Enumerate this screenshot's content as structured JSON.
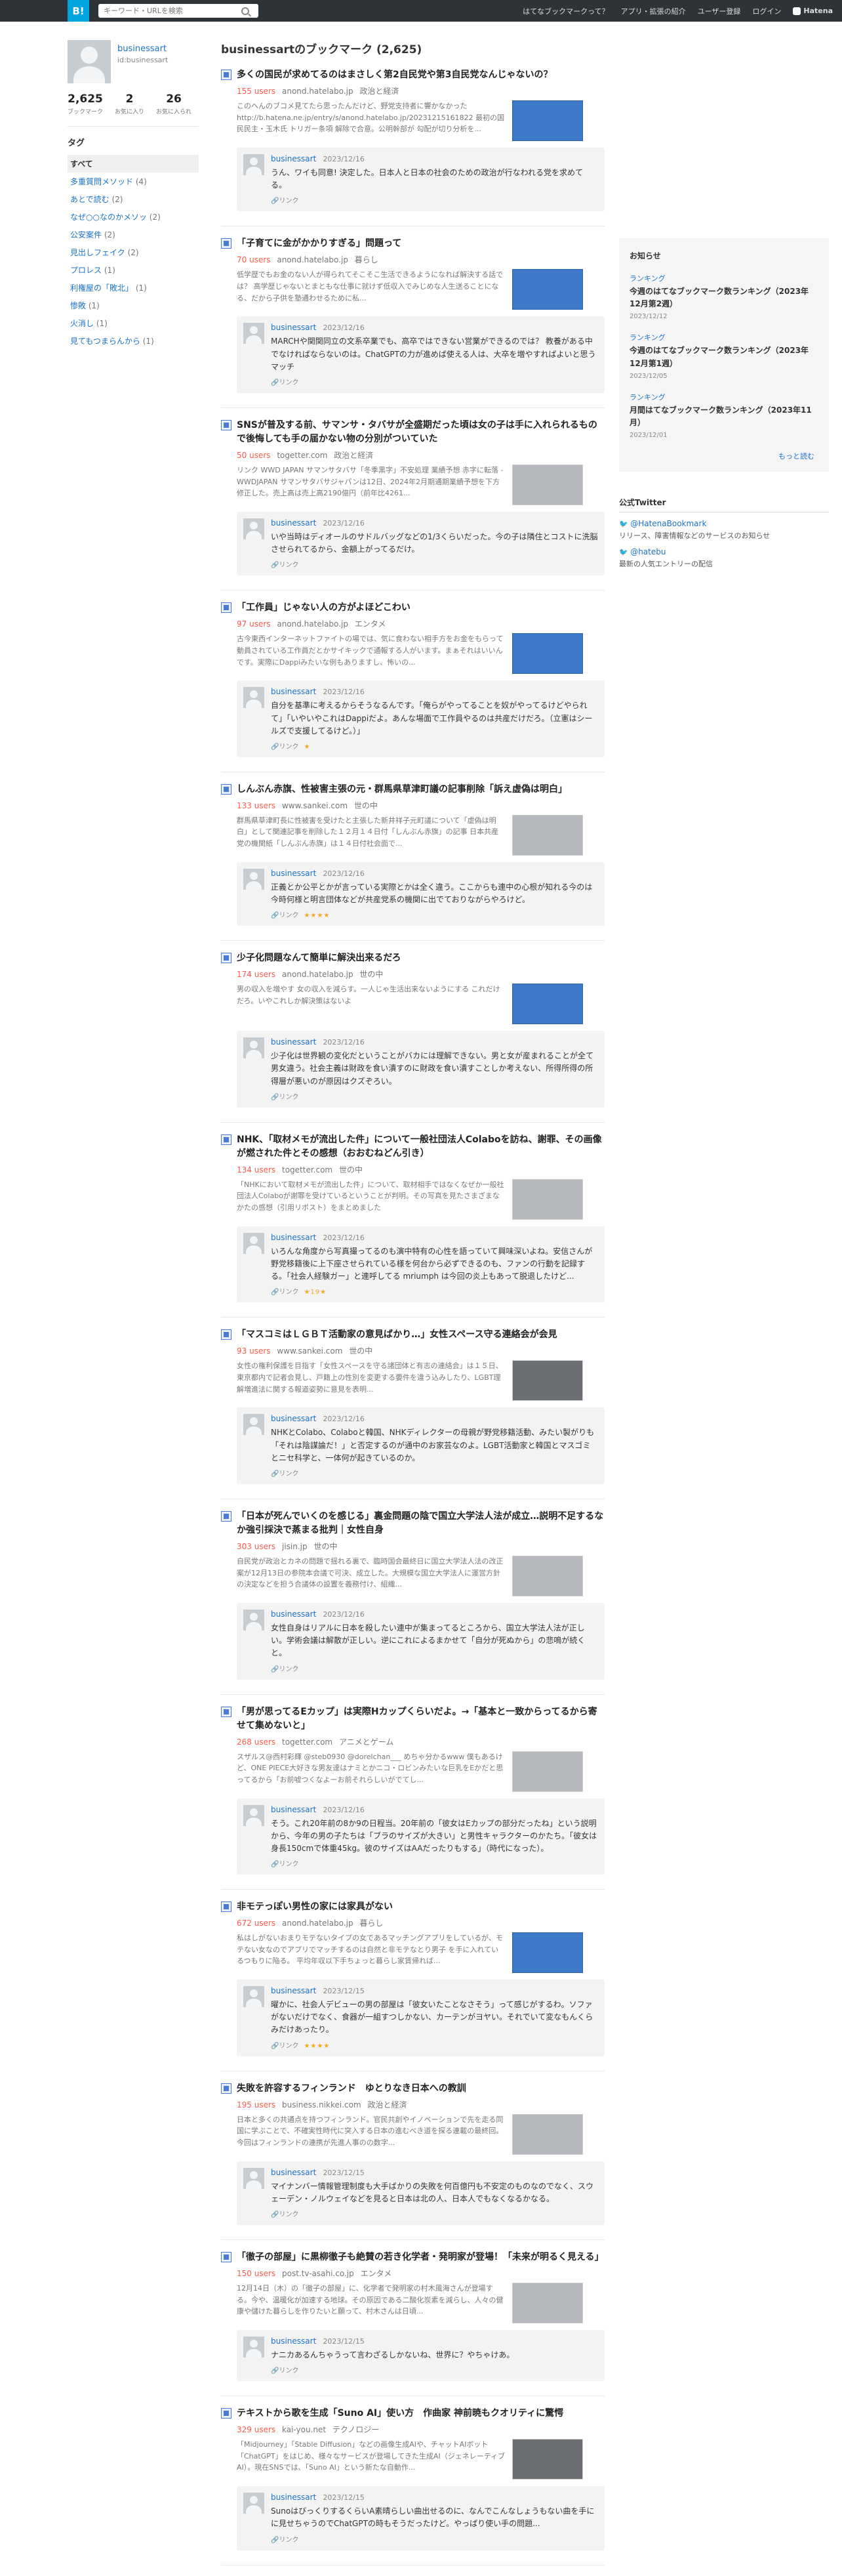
{
  "topbar": {
    "logo": "B!",
    "search_placeholder": "キーワード・URLを検索",
    "nav": [
      "はてなブックマークって？",
      "アプリ・拡張の紹介",
      "ユーザー登録",
      "ログイン"
    ],
    "brand": "Hatena"
  },
  "profile": {
    "name": "businessart",
    "id": "id:businessart",
    "stats": [
      {
        "num": "2,625",
        "label": "ブックマーク"
      },
      {
        "num": "2",
        "label": "お気に入り"
      },
      {
        "num": "26",
        "label": "お気に入られ"
      }
    ]
  },
  "tags": {
    "title": "タグ",
    "items": [
      {
        "label": "すべて",
        "count": ""
      },
      {
        "label": "多重質問メソッド",
        "count": "(4)"
      },
      {
        "label": "あとで読む",
        "count": "(2)"
      },
      {
        "label": "なぜ○○なのかメソッ",
        "count": "(2)"
      },
      {
        "label": "公安案件",
        "count": "(2)"
      },
      {
        "label": "見出しフェイク",
        "count": "(2)"
      },
      {
        "label": "プロレス",
        "count": "(1)"
      },
      {
        "label": "利権屋の「敗北」",
        "count": "(1)"
      },
      {
        "label": "惨敗",
        "count": "(1)"
      },
      {
        "label": "火消し",
        "count": "(1)"
      },
      {
        "label": "見てもつまらんから",
        "count": "(1)"
      }
    ]
  },
  "main": {
    "title": "businessartのブックマーク (2,625)",
    "entries": [
      {
        "title": "多くの国民が求めてるのはまさしく第2自民党や第3自民党なんじゃないの？",
        "users": "155 users",
        "domain": "anond.hatelabo.jp",
        "category": "政治と経済",
        "summary": "このへんのブコメ見てたら思ったんだけど、野党支持者に響かなかった http://b.hatena.ne.jp/entry/s/anond.hatelabo.jp/20231215161822 最初の国民民主・玉木氏 トリガー条項 解除で合意。公明幹部が 勾配が切り分析を...",
        "thumb": "blue",
        "comment_user": "businessart",
        "comment_date": "2023/12/16",
        "comment": "うん、ワイも同意! 決定した。日本人と日本の社会のための政治が行なわれる党を求めてる。",
        "stars": ""
      },
      {
        "title": "「子育てに金がかかりすぎる」問題って",
        "users": "70 users",
        "domain": "anond.hatelabo.jp",
        "category": "暮らし",
        "summary": "低学歴でもお金のない人が得られてそこそこ生活できるようになれば解決する話では？ 高学歴じゃないとまともな仕事に就けず低収入でみじめな人生送ることになる、だから子供を塾通わせるために私...",
        "thumb": "blue",
        "comment_user": "businessart",
        "comment_date": "2023/12/16",
        "comment": "MARCHや関関同立の文系卒業でも、高卒ではできない営業ができるのでは？ 教養がある中でなければならないのは。ChatGPTの力が進めば使える人は、大卒を増やすればよいと思うマッチ",
        "stars": ""
      },
      {
        "title": "SNSが普及する前、サマンサ・タバサが全盛期だった頃は女の子は手に入れられるもので後悔しても手の届かない物の分別がついていた",
        "users": "50 users",
        "domain": "togetter.com",
        "category": "政治と経済",
        "summary": "リンク WWD JAPAN サマンサタバサ「冬季黒字」不安処理 業績予想 赤字に転落 - WWDJAPAN サマンサタバサジャパンは12日、2024年2月期通期業績予想を下方修正した。売上高は売上高2190億円（前年比4261...",
        "thumb": "gray",
        "comment_user": "businessart",
        "comment_date": "2023/12/16",
        "comment": "いや当時はディオールのサドルバッグなどの1/3くらいだった。今の子は隣住とコストに洗脳させられてるから、金額上がってるだけ。",
        "stars": ""
      },
      {
        "title": "「工作員」じゃない人の方がよほどこわい",
        "users": "97 users",
        "domain": "anond.hatelabo.jp",
        "category": "エンタメ",
        "summary": "古今東西インターネットファイトの場では、気に食わない相手方をお金をもらって動員されている工作員だとかサイキックで通報する人がいます。まぁそれはいいんです。実際にDappiみたいな例もありますし、怖いの...",
        "thumb": "blue",
        "comment_user": "businessart",
        "comment_date": "2023/12/16",
        "comment": "自分を基準に考えるからそうなるんです。「俺らがやってることを奴がやってるけどやられて」「いやいやこれはDappiだよ。あんな場面で工作員やるのは共産だけだろ。（立憲はシールズで支援してるけど。）」",
        "stars": "★"
      },
      {
        "title": "しんぶん赤旗、性被害主張の元・群馬県草津町議の記事削除「訴え虚偽は明白」",
        "users": "133 users",
        "domain": "www.sankei.com",
        "category": "世の中",
        "summary": "群馬県草津町長に性被害を受けたと主張した新井祥子元町議について「虚偽は明白」として関連記事を削除した１２月１４日付「しんぶん赤旗」の記事 日本共産党の機関紙「しんぶん赤旗」は１４日付社会面で...",
        "thumb": "gray",
        "comment_user": "businessart",
        "comment_date": "2023/12/16",
        "comment": "正義とか公平とかが言っている実際とかは全く違う。ここからも連中の心根が知れる今のは今時何様と明言団体などが共産党系の機関に出でておりながらやろけど。",
        "stars": "★★★★"
      },
      {
        "title": "少子化問題なんて簡単に解決出来るだろ",
        "users": "174 users",
        "domain": "anond.hatelabo.jp",
        "category": "世の中",
        "summary": "男の収入を増やす 女の収入を減らす。一人じゃ生活出来ないようにする これだけだろ。いやこれしか解決策はないよ",
        "thumb": "blue",
        "comment_user": "businessart",
        "comment_date": "2023/12/16",
        "comment": "少子化は世界観の変化だということがバカには理解できない。男と女が産まれることが全て男女違う。社会主義は財政を食い潰すのに財政を食い潰すことしか考えない、所得所得の所得層が悪いのが原因はクズぞろい。",
        "stars": ""
      },
      {
        "title": "NHK、「取材メモが流出した件」について一般社団法人Colaboを訪ね、謝罪、その画像が燃された件とその感想（おおむねどん引き）",
        "users": "134 users",
        "domain": "togetter.com",
        "category": "世の中",
        "summary": "「NHKにおいて取材メモが流出した件」について、取材相手ではなくなぜか一般社団法人Colaboが謝罪を受けているということが判明。その写真を見たさまざまなかたの感想（引用リポスト）をまとめました",
        "thumb": "gray",
        "comment_user": "businessart",
        "comment_date": "2023/12/16",
        "comment": "いろんな角度から写真撮ってるのも演中特有の心性を語っていて興味深いよね。安信さんが野党移籍後に上下座させられている様を何台から必ずできるのも、ファンの行動を記録する。「社会人経験ガー」と連呼してる mriumph は今回の炎上もあって脱退したけど...",
        "stars": "★19★"
      },
      {
        "title": "「マスコミはＬＧＢＴ活動家の意見ばかり…」女性スペース守る連絡会が会見",
        "users": "93 users",
        "domain": "www.sankei.com",
        "category": "世の中",
        "summary": "女性の権利保護を目指す「女性スペースを守る諸団体と有志の連絡会」は１５日、東京都内で記者会見し、戸籍上の性別を変更する要件を違う込みしたり、LGBT理解増進法に関する報道姿勢に意見を表明...",
        "thumb": "dark",
        "comment_user": "businessart",
        "comment_date": "2023/12/16",
        "comment": "NHKとColabo、Colaboと韓国、NHKディレクターの母親が野党移籍活動、みたい製がりも「それは陰謀論だ！」と否定するのが通中のお家芸なのよ。LGBT活動家と韓国とマスゴミとニセ科学と、一体何が起きているのか。",
        "stars": ""
      },
      {
        "title": "「日本が死んでいくのを感じる」裏金問題の陰で国立大学法人法が成立…説明不足するなか強引採決で蒸まる批判｜女性自身",
        "users": "303 users",
        "domain": "jisin.jp",
        "category": "世の中",
        "summary": "自民党が政治とカネの問題で揺れる裏で、臨時国会最終日に国立大学法人法の改正案が12月13日の参院本会議で可決、成立した。大規模な国立大学法人に運営方針の決定などを担う合議体の設置を義務付け、組織...",
        "thumb": "gray",
        "comment_user": "businessart",
        "comment_date": "2023/12/16",
        "comment": "女性自身はリアルに日本を殺したい連中が集まってるところから、国立大学法人法が正しい。学術会議は解散が正しい。逆にこれによるまかせて「自分が死ぬから」の悲鳴が続くと。",
        "stars": ""
      },
      {
        "title": "「男が思ってるEカップ」は実際Hカップくらいだよ。→「基本と一致からってるから寄せて集めないと」",
        "users": "268 users",
        "domain": "togetter.com",
        "category": "アニメとゲーム",
        "summary": "スザルス@西村彩輝 @steb0930 @dorelchan___ めちゃ分かるwww 僕もあるけど、ONE PIECE大好きな男友達はナミとかニコ・ロビンみたいな巨乳をEかだと思ってるから「お前嘘つくなよーお前それらしいがでてし...",
        "thumb": "gray",
        "comment_user": "businessart",
        "comment_date": "2023/12/16",
        "comment": "そう。これ20年前の8か9の日程当。20年前の「彼女はEカップの部分だったね」という説明から、今年の男の子たちは「ブラのサイズが大きい」と男性キャラクターのかたち。「彼女は身長150cmで体重45kg。彼のサイズはAAだったりもする」（時代になった）。",
        "stars": ""
      },
      {
        "title": "非モテっぽい男性の家には家具がない",
        "users": "672 users",
        "domain": "anond.hatelabo.jp",
        "category": "暮らし",
        "summary": "私はしがないおまりモテないタイプの女であるマッチングアプリをしているが、モテない女なのでアプリでマッチするのは自然と非モテなとり男子 を手に入れているつもりに陥る。 平均年収以下手ちょっと暮らし家賃帰れば...",
        "thumb": "blue",
        "comment_user": "businessart",
        "comment_date": "2023/12/15",
        "comment": "曜かに、社会人デビューの男の部屋は「彼女いたことなさそう」って感じがするわ。ソファがないだけでなく、食器が一組すつしかない、カーテンがヨヤい。それでいて変なもんくらみだけあったり。",
        "stars": "★★★★"
      },
      {
        "title": "失敗を許容するフィンランド　ゆとりなき日本への教訓",
        "users": "195 users",
        "domain": "business.nikkei.com",
        "category": "政治と経済",
        "summary": "日本と多くの共通点を持つフィンランド。官民共創やイノベーションで先を走る同国に学ぶことで、不確実性時代に突入する日本の進むべき道を探る連載の最終回。今回はフィンランドの連携が先進人事のの数字...",
        "thumb": "gray",
        "comment_user": "businessart",
        "comment_date": "2023/12/15",
        "comment": "マイナンバー情報管理制度も大手ばかりの失敗を何百億円も不安定のものなのでなく、スウェーデン・ノルウェイなどを見ると日本は北の人、日本人でもなくなるかなる。",
        "stars": ""
      },
      {
        "title": "「徹子の部屋」に黒柳徹子も絶賛の若き化学者・発明家が登場！「未来が明るく見える」",
        "users": "150 users",
        "domain": "post.tv-asahi.co.jp",
        "category": "エンタメ",
        "summary": "12月14日（木）の「徹子の部屋」に、化学者で発明家の村木風海さんが登場する。今や、温暖化が加速する地球。その原因である二酸化炭素を減らし、人々の健康や儲けた暮らしを作りたいと願って、村木さんは日頃...",
        "thumb": "gray",
        "comment_user": "businessart",
        "comment_date": "2023/12/15",
        "comment": "ナニカあるんちゃうって言わざるしかないね、世界に？やちゃけあ。",
        "stars": ""
      },
      {
        "title": "テキストから歌を生成「Suno AI」使い方　作曲家 神前暁もクオリティに驚愕",
        "users": "329 users",
        "domain": "kai-you.net",
        "category": "テクノロジー",
        "summary": "「Midjourney」「Stable Diffusion」などの画像生成AIや、チャットAIボット「ChatGPT」をはじめ、様々なサービスが登場してきた生成AI（ジェネレーティブAI）。現在SNSでは、「Suno AI」という新たな自動作...",
        "thumb": "dark",
        "comment_user": "businessart",
        "comment_date": "2023/12/15",
        "comment": "SunoはびっくりするくらいA素晴らしい曲出せるのに、なんでこんなしょうもない曲を手にに見せちゃうのでChatGPTの時もそうだったけど。やっぱり使い手の問題...",
        "stars": ""
      }
    ]
  },
  "right": {
    "notice_title": "お知らせ",
    "notices": [
      {
        "category": "ランキング",
        "text": "今週のはてなブックマーク数ランキング（2023年12月第2週）",
        "date": "2023/12/12"
      },
      {
        "category": "ランキング",
        "text": "今週のはてなブックマーク数ランキング（2023年12月第1週）",
        "date": "2023/12/05"
      },
      {
        "category": "ランキング",
        "text": "月間はてなブックマーク数ランキング（2023年11月）",
        "date": "2023/12/01"
      }
    ],
    "more": "もっと読む",
    "twitter_title": "公式Twitter",
    "twitter": [
      {
        "handle": "@HatenaBookmark",
        "desc": "リリース、障害情報などのサービスのお知らせ"
      },
      {
        "handle": "@hatebu",
        "desc": "最新の人気エントリーの配信"
      }
    ]
  }
}
